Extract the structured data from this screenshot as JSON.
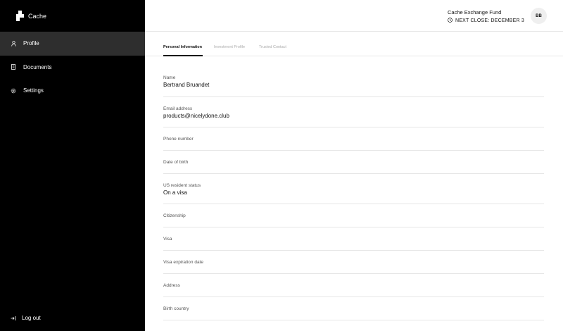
{
  "sidebar": {
    "brand": {
      "name": "Cache"
    },
    "items": [
      {
        "label": "Profile",
        "icon": "user-icon",
        "active": true
      },
      {
        "label": "Documents",
        "icon": "document-icon",
        "active": false
      },
      {
        "label": "Settings",
        "icon": "gear-icon",
        "active": false
      }
    ],
    "logout": {
      "label": "Log out",
      "icon": "logout-icon"
    }
  },
  "header": {
    "fund_name": "Cache Exchange Fund",
    "next_close": "NEXT CLOSE: DECEMBER 3",
    "avatar_initials": "BB"
  },
  "tabs": [
    {
      "label": "Personal Information",
      "active": true
    },
    {
      "label": "Investment Profile",
      "active": false
    },
    {
      "label": "Trusted Contact",
      "active": false
    }
  ],
  "fields": [
    {
      "label": "Name",
      "value": "Bertrand Bruandet"
    },
    {
      "label": "Email address",
      "value": "products@nicelydone.club"
    },
    {
      "label": "Phone number",
      "value": ""
    },
    {
      "label": "Date of birth",
      "value": ""
    },
    {
      "label": "US resident status",
      "value": "On a visa"
    },
    {
      "label": "Citizenship",
      "value": ""
    },
    {
      "label": "Visa",
      "value": ""
    },
    {
      "label": "Visa expiration date",
      "value": ""
    },
    {
      "label": "Address",
      "value": ""
    },
    {
      "label": "Birth country",
      "value": ""
    }
  ],
  "colors": {
    "sidebar_bg": "#000000",
    "active_item_bg": "#2e2e2e",
    "divider": "#e6e6e6"
  }
}
